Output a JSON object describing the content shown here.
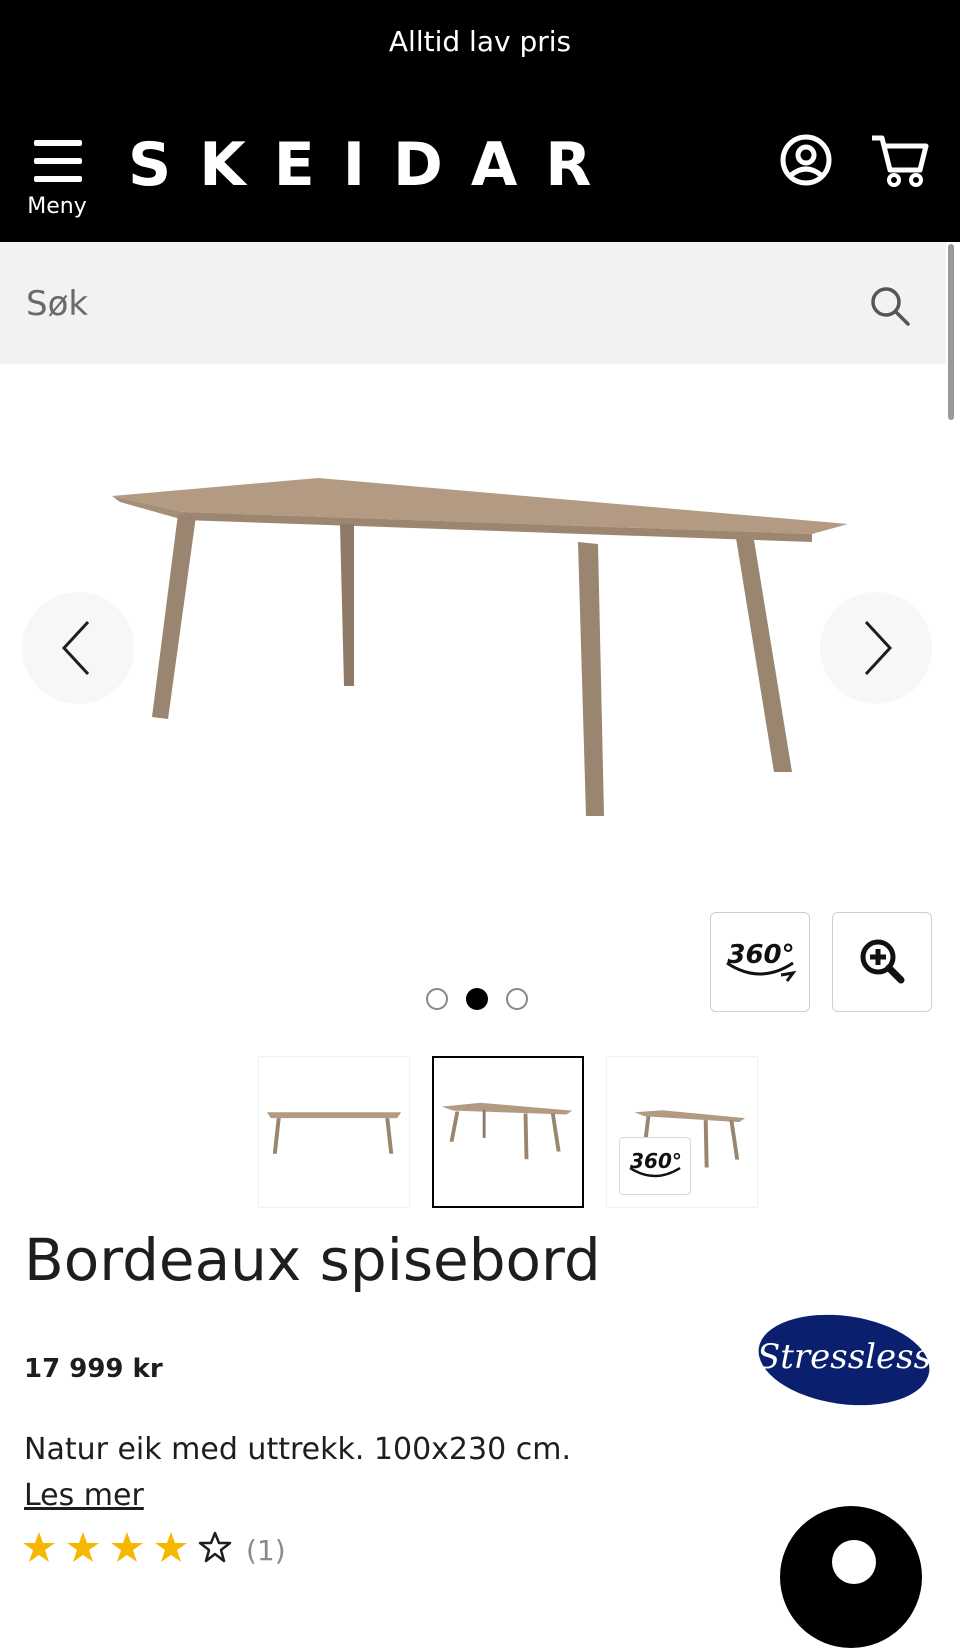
{
  "banner": {
    "text": "Alltid lav pris"
  },
  "header": {
    "menu_label": "Meny",
    "logo_text": "SKEIDAR",
    "icons": [
      "menu-icon",
      "user-icon",
      "cart-icon"
    ]
  },
  "search": {
    "placeholder": "Søk",
    "value": ""
  },
  "gallery": {
    "badge_360": "360°",
    "slide_count": 3,
    "active_slide": 2,
    "thumbnails": [
      "table-front",
      "table-angle",
      "table-360"
    ]
  },
  "product": {
    "title": "Bordeaux spisebord",
    "price": "17 999 kr",
    "brand": "Stressless",
    "description": "Natur eik med uttrekk. 100x230 cm.",
    "read_more": "Les mer",
    "rating": 4,
    "rating_max": 5,
    "rating_count": "(1)"
  },
  "colors": {
    "header_bg": "#000000",
    "search_bg": "#f2f2f2",
    "star": "#f5b700",
    "brand_blue": "#0a1f6e",
    "wood": "#a8927a"
  }
}
